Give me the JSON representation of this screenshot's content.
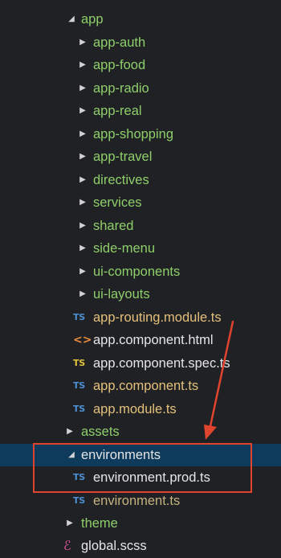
{
  "explorer": {
    "accent_arrow_color": "#e0442f",
    "selection_color": "#0e3a5b",
    "rows": [
      {
        "label": "app",
        "kind": "folder",
        "expanded": true,
        "depth": 0,
        "color": "#8fcf6a"
      },
      {
        "label": "app-auth",
        "kind": "folder",
        "expanded": false,
        "depth": 1,
        "color": "#8fcf6a"
      },
      {
        "label": "app-food",
        "kind": "folder",
        "expanded": false,
        "depth": 1,
        "color": "#8fcf6a"
      },
      {
        "label": "app-radio",
        "kind": "folder",
        "expanded": false,
        "depth": 1,
        "color": "#8fcf6a"
      },
      {
        "label": "app-real",
        "kind": "folder",
        "expanded": false,
        "depth": 1,
        "color": "#8fcf6a"
      },
      {
        "label": "app-shopping",
        "kind": "folder",
        "expanded": false,
        "depth": 1,
        "color": "#8fcf6a"
      },
      {
        "label": "app-travel",
        "kind": "folder",
        "expanded": false,
        "depth": 1,
        "color": "#8fcf6a"
      },
      {
        "label": "directives",
        "kind": "folder",
        "expanded": false,
        "depth": 1,
        "color": "#8fcf6a"
      },
      {
        "label": "services",
        "kind": "folder",
        "expanded": false,
        "depth": 1,
        "color": "#8fcf6a"
      },
      {
        "label": "shared",
        "kind": "folder",
        "expanded": false,
        "depth": 1,
        "color": "#8fcf6a"
      },
      {
        "label": "side-menu",
        "kind": "folder",
        "expanded": false,
        "depth": 1,
        "color": "#8fcf6a"
      },
      {
        "label": "ui-components",
        "kind": "folder",
        "expanded": false,
        "depth": 1,
        "color": "#8fcf6a"
      },
      {
        "label": "ui-layouts",
        "kind": "folder",
        "expanded": false,
        "depth": 1,
        "color": "#8fcf6a"
      },
      {
        "label": "app-routing.module.ts",
        "kind": "file",
        "icon": "ts-icon",
        "icon_text": "TS",
        "depth": 1,
        "color": "#e5c07b"
      },
      {
        "label": "app.component.html",
        "kind": "file",
        "icon": "html-icon",
        "icon_text": "<>",
        "depth": 1,
        "color": "#e6e6e6"
      },
      {
        "label": "app.component.spec.ts",
        "kind": "file",
        "icon": "ts-spec-icon",
        "icon_text": "TS",
        "depth": 1,
        "color": "#e6e6e6"
      },
      {
        "label": "app.component.ts",
        "kind": "file",
        "icon": "ts-icon",
        "icon_text": "TS",
        "depth": 1,
        "color": "#e5c07b"
      },
      {
        "label": "app.module.ts",
        "kind": "file",
        "icon": "ts-icon",
        "icon_text": "TS",
        "depth": 1,
        "color": "#e5c07b"
      },
      {
        "label": "assets",
        "kind": "folder",
        "expanded": false,
        "depth": 0,
        "color": "#8fcf6a"
      },
      {
        "label": "environments",
        "kind": "folder",
        "expanded": true,
        "depth": 0,
        "selected": true,
        "color": "#e4e4e4"
      },
      {
        "label": "environment.prod.ts",
        "kind": "file",
        "icon": "ts-icon",
        "icon_text": "TS",
        "depth": 1,
        "color": "#e6e6e6"
      },
      {
        "label": "environment.ts",
        "kind": "file",
        "icon": "ts-icon",
        "icon_text": "TS",
        "depth": 1,
        "color": "#c6b27e"
      },
      {
        "label": "theme",
        "kind": "folder",
        "expanded": false,
        "depth": 0,
        "color": "#8fcf6a"
      },
      {
        "label": "global.scss",
        "kind": "file",
        "icon": "scss-icon",
        "icon_text": "ℰ",
        "depth": 0,
        "color": "#e6e6e6"
      }
    ]
  }
}
